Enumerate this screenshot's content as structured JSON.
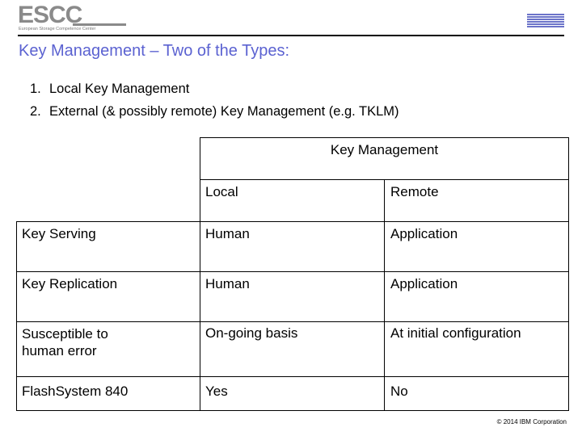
{
  "header": {
    "left_logo": {
      "mark": "ESCC",
      "subtitle": "European Storage Competence Center"
    },
    "right_logo": {
      "mark": "IBM",
      "color": "#6b73c9"
    }
  },
  "slide": {
    "title": "Key Management – Two of the Types:",
    "title_color": "#5b62d1",
    "list": [
      {
        "num": "1.",
        "text": "Local Key Management"
      },
      {
        "num": "2.",
        "text": "External (& possibly remote) Key Management (e.g. TKLM)"
      }
    ]
  },
  "table": {
    "group_header": "Key Management",
    "columns": [
      "Local",
      "Remote"
    ],
    "rows": [
      {
        "label": "Key Serving",
        "local": "Human",
        "remote": "Application"
      },
      {
        "label": "Key Replication",
        "local": "Human",
        "remote": "Application"
      },
      {
        "label": "Susceptible to human error",
        "local": "On-going basis",
        "remote": "At initial configuration"
      },
      {
        "label": "FlashSystem 840",
        "local": "Yes",
        "remote": "No"
      }
    ]
  },
  "footer": {
    "copyright": "© 2014 IBM Corporation"
  }
}
